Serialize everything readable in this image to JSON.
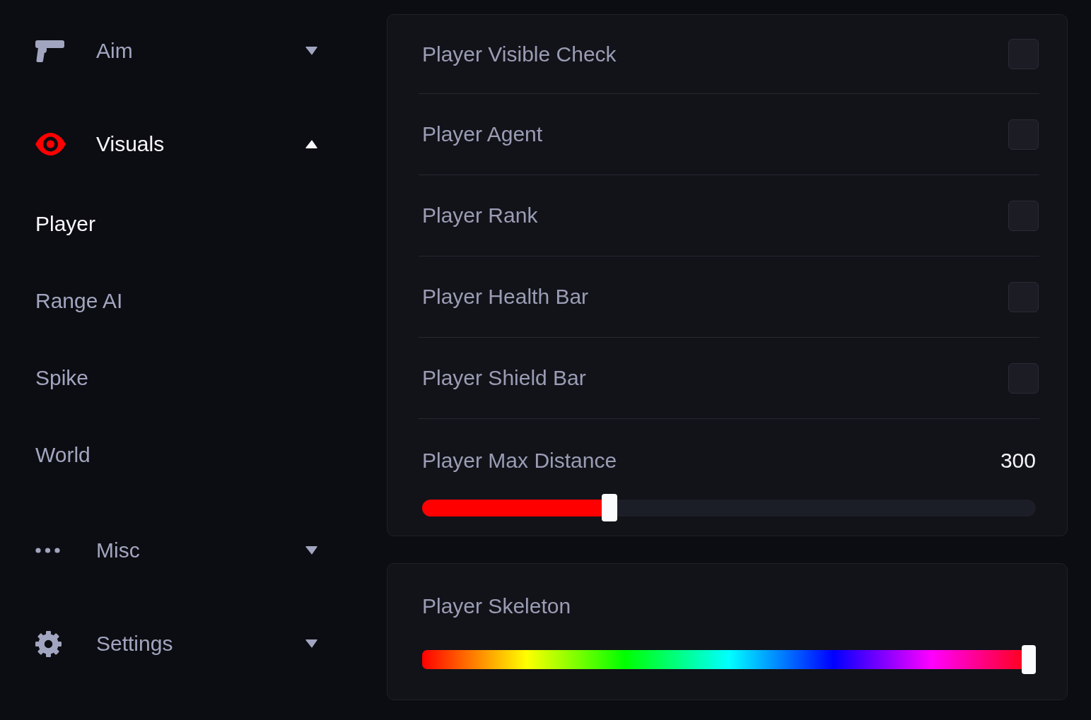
{
  "sidebar": {
    "sections": [
      {
        "label": "Aim",
        "selected": false,
        "expanded": false
      },
      {
        "label": "Visuals",
        "selected": true,
        "expanded": true,
        "children": [
          {
            "label": "Player",
            "selected": true
          },
          {
            "label": "Range AI",
            "selected": false
          },
          {
            "label": "Spike",
            "selected": false
          },
          {
            "label": "World",
            "selected": false
          }
        ]
      },
      {
        "label": "Misc",
        "selected": false,
        "expanded": false
      },
      {
        "label": "Settings",
        "selected": false,
        "expanded": false
      }
    ]
  },
  "panels": [
    {
      "rows": [
        {
          "kind": "checkbox",
          "label": "Player Visible Check",
          "checked": false
        },
        {
          "kind": "checkbox",
          "label": "Player Agent",
          "checked": false
        },
        {
          "kind": "checkbox",
          "label": "Player Rank",
          "checked": false
        },
        {
          "kind": "checkbox",
          "label": "Player Health Bar",
          "checked": false
        },
        {
          "kind": "checkbox",
          "label": "Player Shield Bar",
          "checked": false
        },
        {
          "kind": "slider",
          "label": "Player Max Distance",
          "value": "300",
          "level": 0.3
        }
      ]
    },
    {
      "rows": [
        {
          "kind": "hue",
          "label": "Player Skeleton",
          "level": 1
        }
      ]
    }
  ]
}
